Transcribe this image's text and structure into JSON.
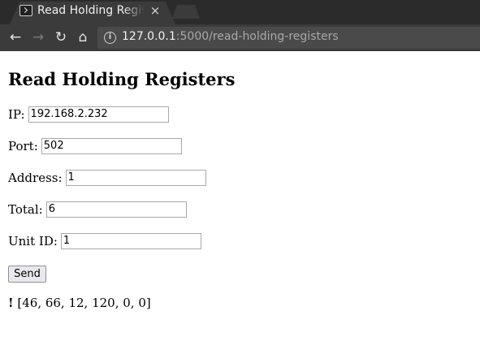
{
  "browser": {
    "tab": {
      "title": "Read Holding Regis",
      "close_symbol": "×"
    },
    "nav": {
      "back": "←",
      "forward": "→",
      "reload": "↻",
      "home": "⌂"
    },
    "address": {
      "host": "127.0.0.1",
      "path": ":5000/read-holding-registers",
      "info_symbol": "i"
    }
  },
  "page": {
    "heading": "Read Holding Registers",
    "form": {
      "ip": {
        "label": "IP:",
        "value": "192.168.2.232"
      },
      "port": {
        "label": "Port:",
        "value": "502"
      },
      "address": {
        "label": "Address:",
        "value": "1"
      },
      "total": {
        "label": "Total:",
        "value": "6"
      },
      "unit_id": {
        "label": "Unit ID:",
        "value": "1"
      },
      "send_label": "Send"
    },
    "result": {
      "marker": "!",
      "text": "[46, 66, 12, 120, 0, 0]"
    }
  }
}
